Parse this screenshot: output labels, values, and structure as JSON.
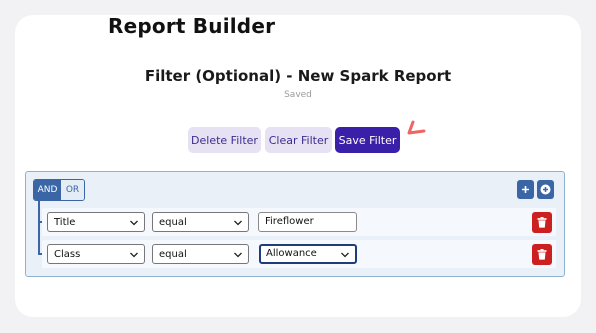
{
  "app": {
    "title": "Report Builder"
  },
  "header": {
    "title": "Filter (Optional) - New Spark Report",
    "status": "Saved"
  },
  "toolbar": {
    "delete_label": "Delete Filter",
    "clear_label": "Clear Filter",
    "save_label": "Save Filter"
  },
  "filter_group": {
    "combinators": [
      "AND",
      "OR"
    ],
    "active_combinator": "AND",
    "add_rule_icon": "plus-icon",
    "add_group_icon": "plus-circle-icon",
    "rules": [
      {
        "field": "Title",
        "operator": "equal",
        "value": "Fireflower",
        "value_kind": "text-input"
      },
      {
        "field": "Class",
        "operator": "equal",
        "value": "Allowance",
        "value_kind": "select"
      }
    ]
  },
  "colors": {
    "primary": "#3a1fa8",
    "soft_button": "#e6e1f3",
    "group_accent": "#3a66a6",
    "danger": "#cc1f1f",
    "annotation": "#f06464"
  }
}
